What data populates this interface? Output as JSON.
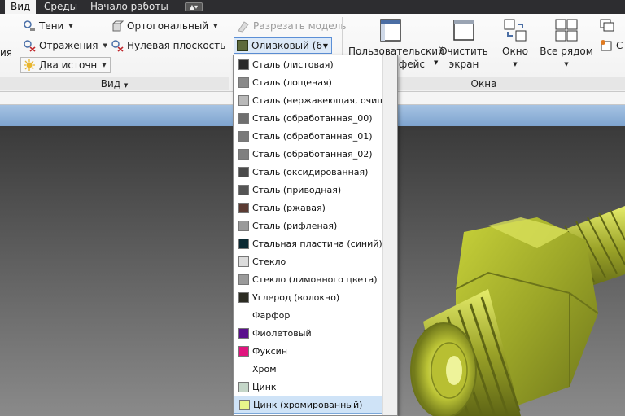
{
  "menu": {
    "tabs": [
      {
        "label": "Вид",
        "active": true
      },
      {
        "label": "Среды",
        "active": false
      },
      {
        "label": "Начало работы",
        "active": false
      }
    ]
  },
  "ribbon": {
    "left_fragment": "ия",
    "shadows_label": "Тени",
    "reflections_label": "Отражения",
    "two_sources_label": "Два источн",
    "orthographic_label": "Ортогональный",
    "ground_plane_label": "Нулевая плоскость",
    "section_model_label": "Разрезать модель",
    "appearance_combo_value": "Оливковый (6",
    "view_panel_label": "Вид",
    "user_interface_label_1": "Пользовательский",
    "user_interface_label_2": "фейс",
    "clean_screen_label_1": "Очистить",
    "clean_screen_label_2": "экран",
    "window_label": "Окно",
    "tile_all_label": "Все рядом",
    "windows_panel_label": "Окна",
    "right_fragment": "С"
  },
  "materials": [
    {
      "label": "Сталь (листовая)",
      "color": "#2a2a2a"
    },
    {
      "label": "Сталь (лощеная)",
      "color": "#8a8a8a"
    },
    {
      "label": "Сталь (нержавеющая, очище",
      "color": "#b9b9b9"
    },
    {
      "label": "Сталь (обработанная_00)",
      "color": "#6f6f6f"
    },
    {
      "label": "Сталь (обработанная_01)",
      "color": "#7a7a7a"
    },
    {
      "label": "Сталь (обработанная_02)",
      "color": "#808080"
    },
    {
      "label": "Сталь (оксидированная)",
      "color": "#4a4a4a"
    },
    {
      "label": "Сталь (приводная)",
      "color": "#555555"
    },
    {
      "label": "Сталь (ржавая)",
      "color": "#5b3b33"
    },
    {
      "label": "Сталь (рифленая)",
      "color": "#9a9a9a"
    },
    {
      "label": "Стальная пластина (синий)",
      "color": "#0c2a33"
    },
    {
      "label": "Стекло",
      "color": "#dcdcdc"
    },
    {
      "label": "Стекло (лимонного цвета)",
      "color": "#9a9a9a"
    },
    {
      "label": "Углерод (волокно)",
      "color": "#2b2b22"
    },
    {
      "label": "Фарфор",
      "color": ""
    },
    {
      "label": "Фиолетовый",
      "color": "#5a0f8c"
    },
    {
      "label": "Фуксин",
      "color": "#e0147e"
    },
    {
      "label": "Хром",
      "color": ""
    },
    {
      "label": "Цинк",
      "color": "#c4d6c8"
    },
    {
      "label": "Цинк (хромированный)",
      "color": "#e8f58a",
      "selected": true
    }
  ]
}
